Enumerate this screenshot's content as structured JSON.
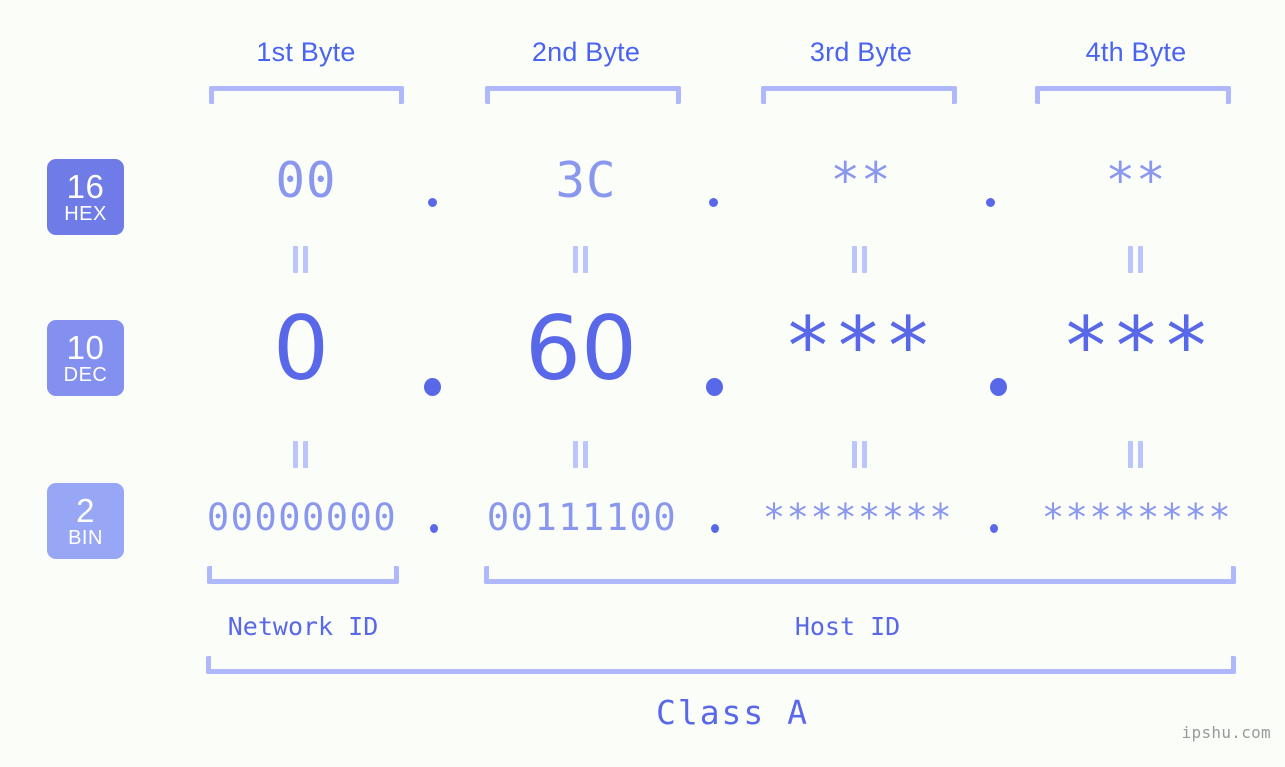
{
  "watermark": "ipshu.com",
  "byte_headers": [
    {
      "label": "1st Byte"
    },
    {
      "label": "2nd Byte"
    },
    {
      "label": "3rd Byte"
    },
    {
      "label": "4th Byte"
    }
  ],
  "bases": [
    {
      "number": "16",
      "name": "HEX",
      "color": "#6f7ce8"
    },
    {
      "number": "10",
      "name": "DEC",
      "color": "#8490f0"
    },
    {
      "number": "2",
      "name": "BIN",
      "color": "#97a6f5"
    }
  ],
  "rows": {
    "hex": {
      "base_number": "16",
      "base_name": "HEX",
      "values": [
        "00",
        "3C",
        "**",
        "**"
      ],
      "separator": "."
    },
    "dec": {
      "base_number": "10",
      "base_name": "DEC",
      "values": [
        "0",
        "60",
        "***",
        "***"
      ],
      "separator": "."
    },
    "bin": {
      "base_number": "2",
      "base_name": "BIN",
      "values": [
        "00000000",
        "00111100",
        "********",
        "********"
      ],
      "separator": "."
    }
  },
  "equals_symbol": "=",
  "segments": {
    "network_id": "Network ID",
    "host_id": "Host ID"
  },
  "class_label": "Class A",
  "colors": {
    "background": "#fbfdf9",
    "accent_strong": "#5868e8",
    "accent_light": "#8a97ee",
    "bracket": "#aeb8fb",
    "equals": "#bcc5fb",
    "header_text": "#4a63f0",
    "watermark": "#9a9a9a"
  }
}
